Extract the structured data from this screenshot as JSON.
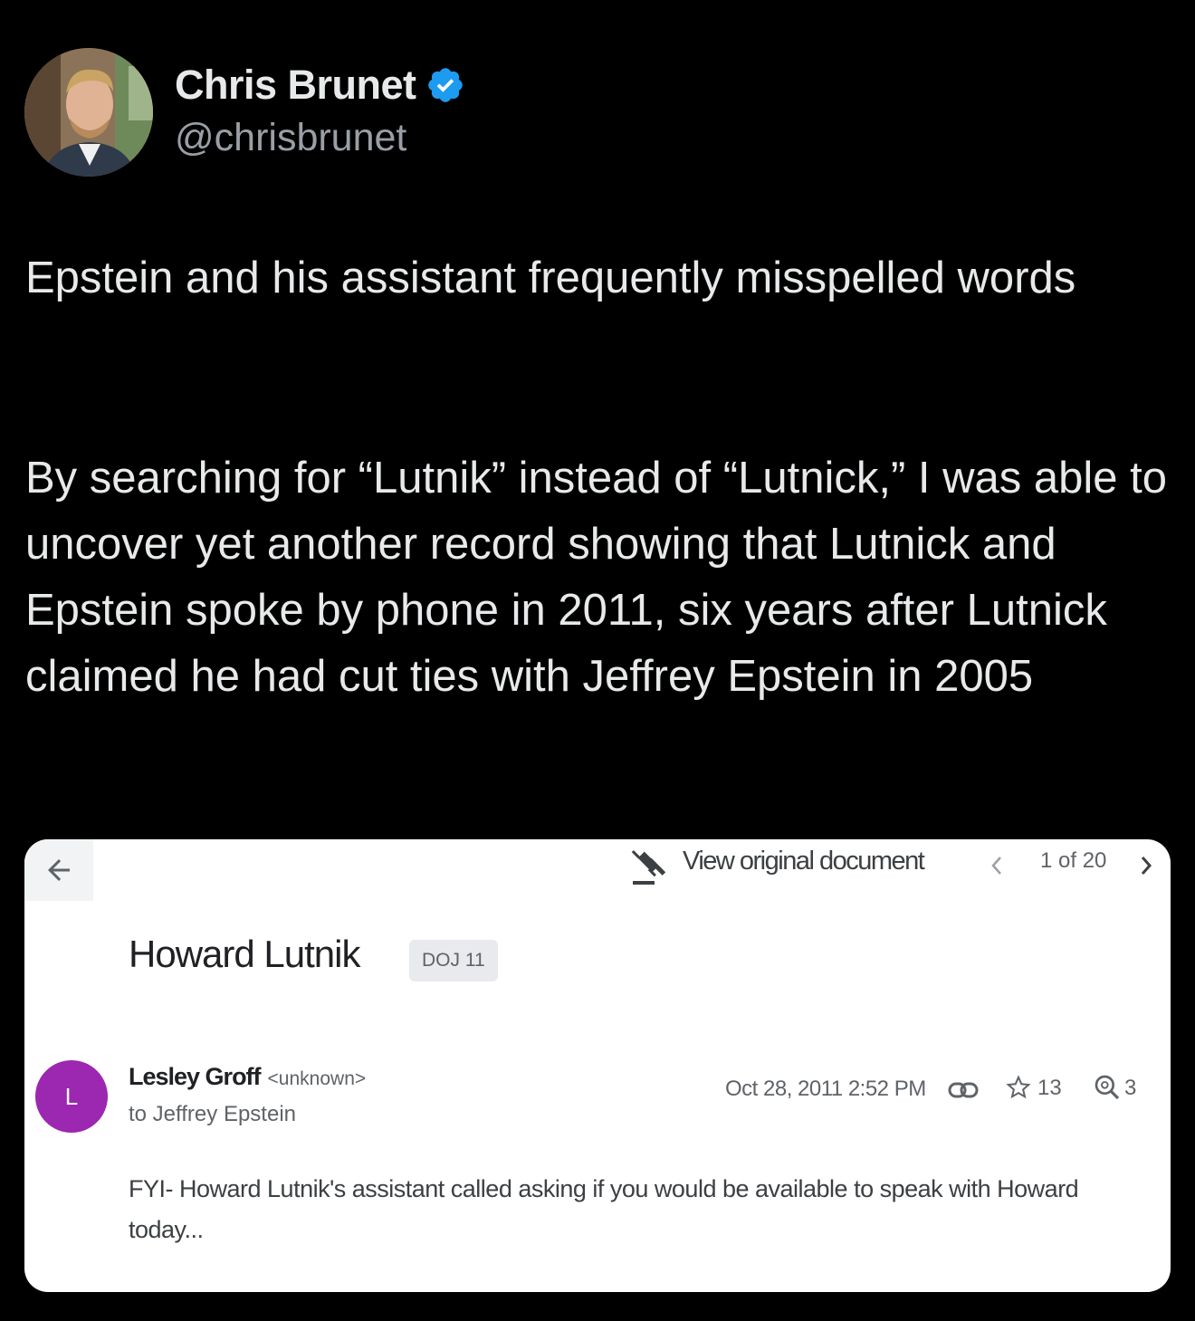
{
  "tweet": {
    "author": {
      "display_name": "Chris Brunet",
      "handle": "@chrisbrunet",
      "verified": true,
      "verified_color": "#1d9bf0"
    },
    "text_paragraphs": [
      "Epstein and his assistant frequently misspelled words",
      "By searching for “Lutnik” instead of “Lutnick,” I was able to uncover yet another record showing that Lutnick and Epstein spoke by phone in 2011, six years after Lutnick  claimed he had cut ties with Jeffrey Epstein in 2005"
    ],
    "colors": {
      "background": "#000000",
      "text": "#e7e9ea",
      "secondary_text": "#9a9fa5"
    }
  },
  "document_card": {
    "toolbar": {
      "back_icon": "arrow-left-icon",
      "view_original_icon": "gavel-icon",
      "view_original_label": "View original document",
      "prev_icon": "chevron-left-icon",
      "pager": "1 of 20",
      "next_icon": "chevron-right-icon"
    },
    "subject": "Howard Lutnik",
    "tag": "DOJ 11",
    "message": {
      "sender_initial": "L",
      "sender_avatar_color": "#9c27b0",
      "sender_name": "Lesley Groff",
      "sender_email": "<unknown>",
      "recipient": "to Jeffrey Epstein",
      "date": "Oct 28, 2011 2:52 PM",
      "link_icon": "link-icon",
      "star_icon": "star-icon",
      "star_count": "13",
      "search_icon": "search-icon",
      "search_count": "3",
      "body": "FYI- Howard Lutnik's assistant called asking if you would be available to speak with Howard today..."
    }
  }
}
